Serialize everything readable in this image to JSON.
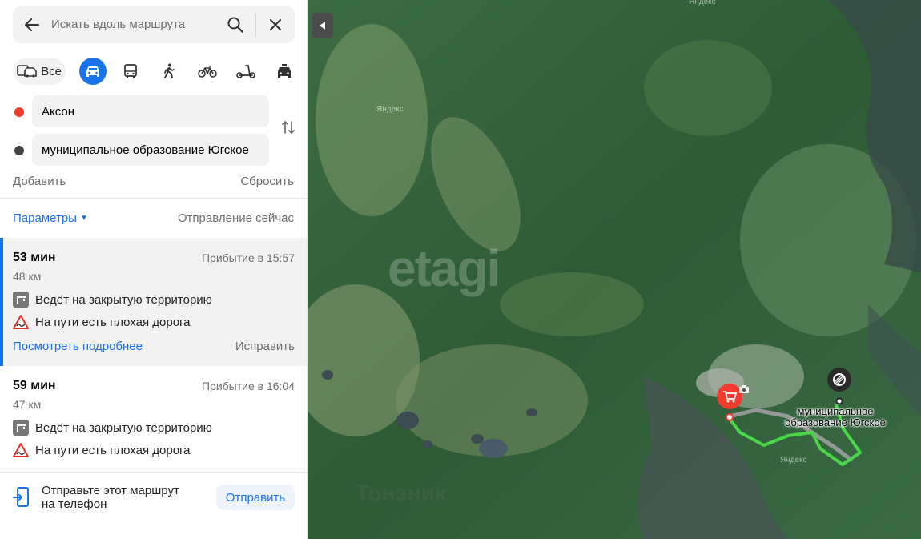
{
  "search": {
    "placeholder": "Искать вдоль маршрута"
  },
  "modes": {
    "all_label": "Все"
  },
  "points": {
    "from": "Аксон",
    "to": "муниципальное образование Югское"
  },
  "actions": {
    "add": "Добавить",
    "reset": "Сбросить"
  },
  "params": {
    "label": "Параметры",
    "departure": "Отправление сейчас"
  },
  "routes": [
    {
      "time": "53 мин",
      "arrival": "Прибытие в 15:57",
      "distance": "48 км",
      "warnings": [
        "Ведёт на закрытую территорию",
        "На пути есть плохая дорога"
      ],
      "details": "Посмотреть подробнее",
      "fix": "Исправить"
    },
    {
      "time": "59 мин",
      "arrival": "Прибытие в 16:04",
      "distance": "47 км",
      "warnings": [
        "Ведёт на закрытую территорию",
        "На пути есть плохая дорога"
      ]
    }
  ],
  "send": {
    "text": "Отправьте этот маршрут на телефон",
    "button": "Отправить"
  },
  "map": {
    "destination_label": "муниципальное образование Югское",
    "attribution": "Яндекс",
    "watermark": "etagi",
    "watermark2": "Тонэник"
  },
  "colors": {
    "accent": "#1a73e8",
    "start_dot": "#f43b2f",
    "route_line": "#4cd44a",
    "warning_red": "#e5302a"
  }
}
